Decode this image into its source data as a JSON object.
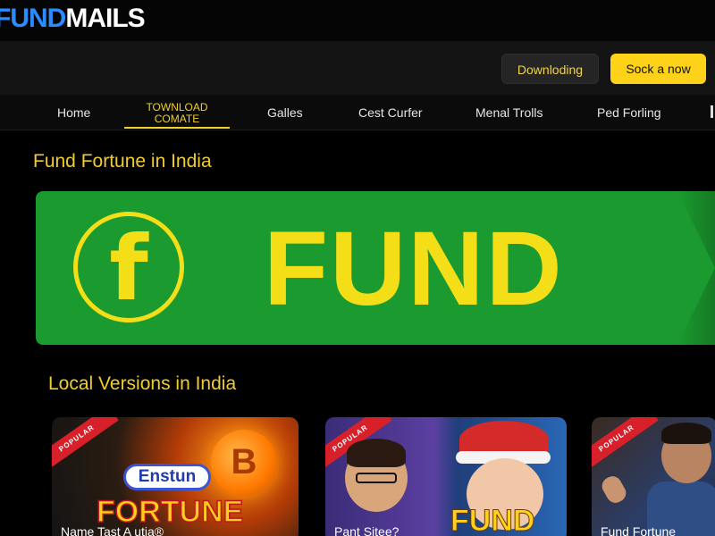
{
  "brand": {
    "part1": "FUND",
    "part2": "MAILS"
  },
  "actions": {
    "downloading_label": "Downloding",
    "stock_label": "Sock a now"
  },
  "nav": {
    "items": [
      {
        "label": "Home"
      },
      {
        "label_line1": "TOWNLOAD",
        "label_line2": "COMATE",
        "active": true
      },
      {
        "label": "Galles"
      },
      {
        "label": "Cest Curfer"
      },
      {
        "label": "Menal Trolls"
      },
      {
        "label": "Ped Forling"
      }
    ]
  },
  "hero": {
    "title": "Fund Fortune in India",
    "banner_logo_letter": "f",
    "banner_word": "FUND",
    "banner_color": "#1b9a2f",
    "banner_text_color": "#f4de17"
  },
  "local": {
    "title": "Local Versions in India",
    "cards": [
      {
        "ribbon": "POPULAR",
        "badge": "Enstun",
        "coin_symbol": "B",
        "big_text": "FORTUNE",
        "caption": "Name Tast A utia®"
      },
      {
        "ribbon": "POPULAR",
        "big_text": "FUND",
        "caption": "Pant Sitee?"
      },
      {
        "ribbon": "POPULAR",
        "caption": "Fund Fortune"
      }
    ]
  },
  "colors": {
    "accent": "#f0cd2e",
    "button_yellow": "#ffd21a",
    "background": "#000000"
  }
}
